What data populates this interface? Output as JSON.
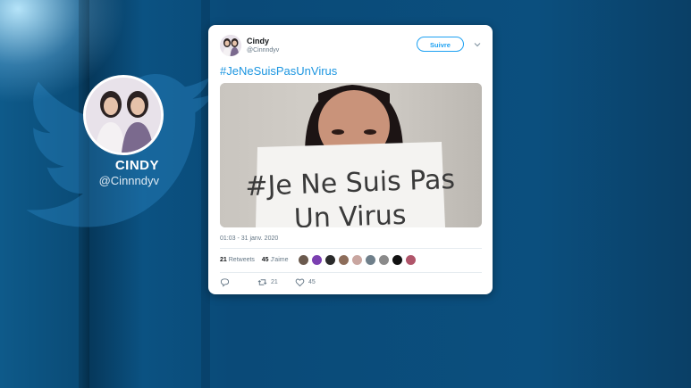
{
  "profile": {
    "display_name": "CINDY",
    "handle": "@Cinnndyv"
  },
  "tweet": {
    "author_name": "Cindy",
    "author_handle": "@Cinnndyv",
    "follow_label": "Suivre",
    "text": "#JeNeSuisPasUnVirus",
    "sign_text_line1": "#Je Ne Suis Pas",
    "sign_text_line2": "Un Virus",
    "timestamp": "01:03 - 31 janv. 2020",
    "retweets_count": "21",
    "retweets_label": "Retweets",
    "likes_count": "45",
    "likes_label": "J'aime",
    "reply_count": "",
    "retweet_action_count": "21",
    "like_action_count": "45"
  },
  "colors": {
    "accent": "#1da1f2",
    "hashtag": "#1b95e0",
    "card_bg": "#ffffff",
    "background": "#0b4f7e"
  },
  "likers": [
    "#6b5a4e",
    "#7b3fb0",
    "#2a2a2a",
    "#8d6d5a",
    "#c9a6a0",
    "#6f7f8a",
    "#8a8a8a",
    "#111111",
    "#b0556a"
  ]
}
